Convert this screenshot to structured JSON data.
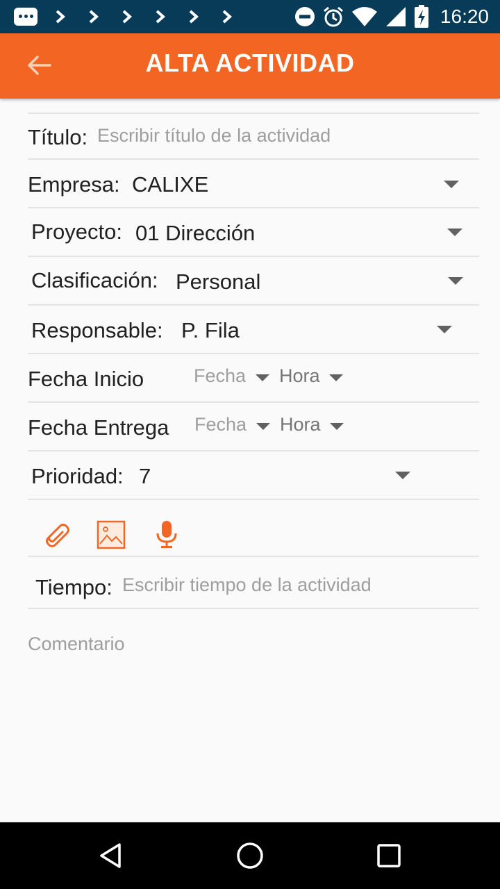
{
  "status_bar": {
    "time": "16:20",
    "icons": [
      "message-icon",
      "chevron-right-icon",
      "chevron-right-icon",
      "chevron-right-icon",
      "chevron-right-icon",
      "chevron-right-icon",
      "chevron-right-icon",
      "do-not-disturb-icon",
      "alarm-icon",
      "wifi-icon",
      "signal-icon",
      "battery-charging-icon"
    ]
  },
  "app_bar": {
    "title": "ALTA ACTIVIDAD",
    "back_icon": "arrow-left-icon"
  },
  "form": {
    "titulo": {
      "label": "Título:",
      "placeholder": "Escribir título de la actividad"
    },
    "empresa": {
      "label": "Empresa:",
      "value": "CALIXE"
    },
    "proyecto": {
      "label": "Proyecto:",
      "value": "01 Dirección"
    },
    "clasificacion": {
      "label": "Clasificación:",
      "value": "Personal"
    },
    "responsable": {
      "label": "Responsable:",
      "value": "P. Fila"
    },
    "fecha_inicio": {
      "label": "Fecha Inicio",
      "date": "Fecha",
      "time": "Hora"
    },
    "fecha_entrega": {
      "label": "Fecha Entrega",
      "date": "Fecha",
      "time": "Hora"
    },
    "prioridad": {
      "label": "Prioridad:",
      "value": "7"
    },
    "tools": [
      "paperclip-icon",
      "image-icon",
      "microphone-icon"
    ],
    "tiempo": {
      "label": "Tiempo:",
      "placeholder": "Escribir tiempo de la actividad"
    },
    "comentario": {
      "placeholder": "Comentario"
    }
  },
  "colors": {
    "accent": "#f26522",
    "status_bar": "#073b57",
    "background": "#fafafa",
    "nav_bar": "#000000"
  },
  "nav_bar": {
    "buttons": [
      "back-triangle-icon",
      "home-circle-icon",
      "recents-square-icon"
    ]
  }
}
